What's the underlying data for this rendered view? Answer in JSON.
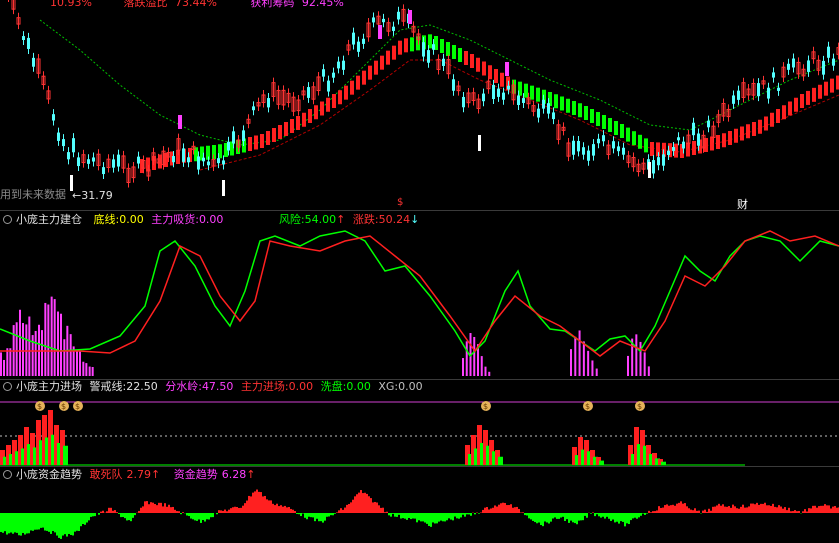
{
  "main": {
    "top_texts": [
      "10.93%",
      "落跌溢比",
      "73.44%",
      "获利筹码",
      "92.45%"
    ],
    "low_price": "31.79",
    "note": "用到未来数据",
    "marker_s": "$",
    "marker_cai": "财"
  },
  "pane1": {
    "title": "小庞主力建仓",
    "dixian_label": "底线:",
    "dixian_value": "0.00",
    "zhuli_label": "主力吸货:",
    "zhuli_value": "0.00",
    "fengxian_label": "风险:",
    "fengxian_value": "54.00",
    "zhangdie_label": "涨跌:",
    "zhangdie_value": "50.24",
    "arrow_up": "↑",
    "arrow_down": "↓"
  },
  "pane2": {
    "title": "小庞主力进场",
    "jingjie_label": "警戒线:",
    "jingjie_value": "22.50",
    "fenshui_label": "分水岭:",
    "fenshui_value": "47.50",
    "jinchang_label": "主力进场:",
    "jinchang_value": "0.00",
    "xipan_label": "洗盘:",
    "xipan_value": "0.00",
    "xg_label": "XG:",
    "xg_value": "0.00",
    "money_icon": "$"
  },
  "pane3": {
    "title": "小庞资金趋势",
    "ganshi_label": "敢死队",
    "ganshi_value": "2.79",
    "zijin_label": "资金趋势",
    "zijin_value": "6.28",
    "arrow_up": "↑"
  },
  "colors": {
    "up": "#ff3333",
    "down": "#54ffff",
    "green": "#00ff00",
    "red": "#ff2020",
    "magenta": "#ff40ff",
    "yellow": "#ffff00",
    "white": "#ffffff",
    "bg": "#000000"
  }
}
